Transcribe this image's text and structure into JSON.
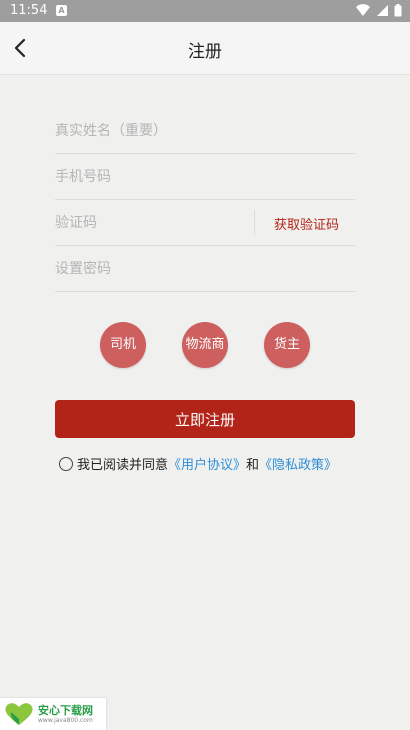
{
  "status_bar": {
    "time": "11:54",
    "app_badge": "A"
  },
  "header": {
    "title": "注册"
  },
  "form": {
    "name_placeholder": "真实姓名（重要）",
    "phone_placeholder": "手机号码",
    "code_placeholder": "验证码",
    "get_code_label": "获取验证码",
    "password_placeholder": "设置密码"
  },
  "roles": [
    "司机",
    "物流商",
    "货主"
  ],
  "register_label": "立即注册",
  "agreement": {
    "prefix": "我已阅读并同意",
    "user_agreement": "《用户协议》",
    "conjunction": "和",
    "privacy_policy": "《隐私政策》"
  },
  "watermark": {
    "name": "安心下载网",
    "url": "www.java800.com"
  },
  "colors": {
    "primary": "#b22418",
    "role_circle": "#cd5f5f",
    "link": "#2f8fd8"
  }
}
